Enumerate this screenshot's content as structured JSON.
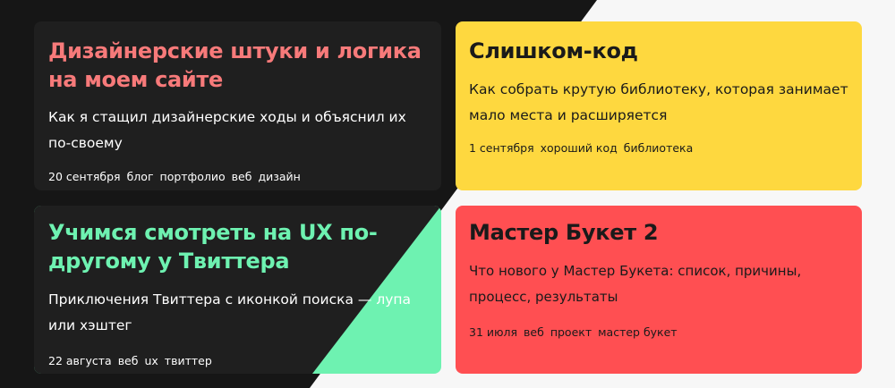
{
  "colors": {
    "dark_bg": "#161616",
    "light_bg": "#f7f7f7",
    "card_dark": "#1f1f1f",
    "salmon": "#f77a7a",
    "yellow": "#fed83f",
    "mint": "#6ef2b1",
    "red": "#ff4f52"
  },
  "cards": [
    {
      "title": "Дизайнерские штуки и логика на моем сайте",
      "description": "Как я стащил дизайнерские ходы и объяснил их по-своему",
      "date": "20 сентября",
      "tags": [
        "блог",
        "портфолио",
        "веб",
        "дизайн"
      ]
    },
    {
      "title": "Слишком-код",
      "description": "Как собрать крутую библиотеку, которая занимает мало места и расширяется",
      "date": "1 сентября",
      "tags": [
        "хороший код",
        "библиотека"
      ]
    },
    {
      "title": "Учимся смотреть на UX по-другому у Твиттера",
      "description": "Приключения Твиттера с иконкой поиска — лупа или хэштег",
      "date": "22 августа",
      "tags": [
        "веб",
        "ux",
        "твиттер"
      ]
    },
    {
      "title": "Мастер Букет 2",
      "description": "Что нового у Мастер Букета: список, причины, процесс, результаты",
      "date": "31 июля",
      "tags": [
        "веб",
        "проект",
        "мастер букет"
      ]
    }
  ]
}
